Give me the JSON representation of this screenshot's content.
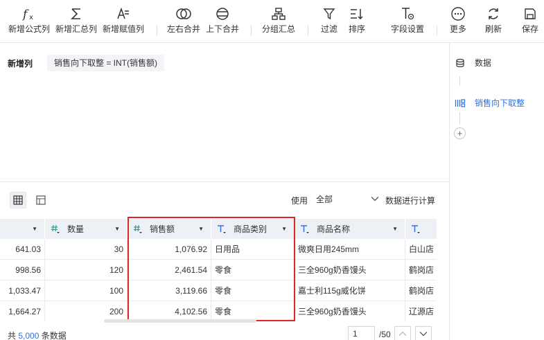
{
  "toolbar": {
    "new_formula": "新增公式列",
    "new_summary": "新增汇总列",
    "new_assign": "新增赋值列",
    "lr_merge": "左右合并",
    "tb_merge": "上下合并",
    "group_sum": "分组汇总",
    "filter": "过滤",
    "sort": "排序",
    "field_settings": "字段设置",
    "more": "更多",
    "refresh": "刷新",
    "save": "保存"
  },
  "formula": {
    "label": "新增列",
    "expression": "销售向下取整 = INT(销售额)"
  },
  "steps": {
    "data": "数据",
    "current": "销售向下取整",
    "add": "+"
  },
  "preview": {
    "use_label": "使用",
    "use_value": "全部",
    "calc_label": "数据进行计算"
  },
  "table": {
    "headers": [
      {
        "name": "",
        "type": "number"
      },
      {
        "name": "数量",
        "type": "number"
      },
      {
        "name": "销售额",
        "type": "number"
      },
      {
        "name": "商品类别",
        "type": "text"
      },
      {
        "name": "商品名称",
        "type": "text"
      },
      {
        "name": "",
        "type": "text"
      }
    ],
    "rows": [
      [
        "641.03",
        "30",
        "1,076.92",
        "日用品",
        "微爽日用245mm",
        "白山店"
      ],
      [
        "998.56",
        "120",
        "2,461.54",
        "零食",
        "三全960g奶香馒头",
        "鹤岗店"
      ],
      [
        "1,033.47",
        "100",
        "3,119.66",
        "零食",
        "嘉士利115g威化饼",
        "鹤岗店"
      ],
      [
        "1,664.27",
        "200",
        "4,102.56",
        "零食",
        "三全960g奶香馒头",
        "辽源店"
      ]
    ]
  },
  "footer": {
    "total_prefix": "共",
    "total_count": "5,000",
    "total_suffix": "条数据",
    "page_current": "1",
    "page_total": "/50"
  },
  "colors": {
    "accent": "#2f6fe0",
    "highlight": "#e02424",
    "number_type": "#2e9e8f",
    "text_type": "#3a6fd8"
  }
}
